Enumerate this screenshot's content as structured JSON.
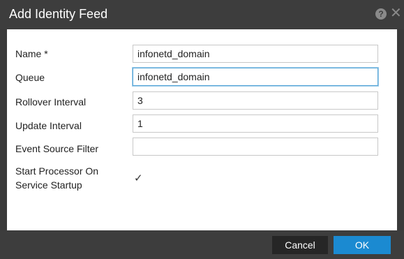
{
  "dialog": {
    "title": "Add Identity Feed",
    "help_icon": "question-circle-icon",
    "close_icon": "close-icon",
    "help_glyph": "?",
    "close_glyph": "✕"
  },
  "form": {
    "name_label": "Name *",
    "name_value": "infonetd_domain",
    "queue_label": "Queue",
    "queue_value": "infonetd_domain",
    "rollover_label": "Rollover Interval",
    "rollover_value": "3",
    "update_label": "Update Interval",
    "update_value": "1",
    "event_filter_label": "Event Source Filter",
    "event_filter_value": "",
    "start_processor_label_line1": "Start Processor On",
    "start_processor_label_line2": "Service Startup",
    "start_processor_checked": true,
    "checkmark_glyph": "✓"
  },
  "footer": {
    "cancel_label": "Cancel",
    "ok_label": "OK"
  },
  "colors": {
    "header_bg": "#3d3d3d",
    "ok_button": "#1b8ad1",
    "cancel_button": "#262626",
    "focus_border": "#5aa7d8"
  }
}
